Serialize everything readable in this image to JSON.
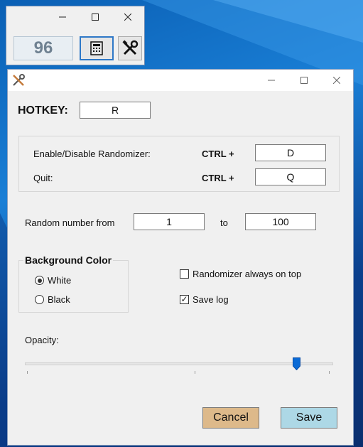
{
  "mini_window": {
    "counter_value": "96",
    "calc_icon": "calculator-icon",
    "tools_icon": "tools-icon"
  },
  "settings": {
    "app_icon": "tools-icon",
    "hotkey_label": "HOTKEY:",
    "hotkey_value": "R",
    "enable_label": "Enable/Disable Randomizer:",
    "enable_mod": "CTRL +",
    "enable_key": "D",
    "quit_label": "Quit:",
    "quit_mod": "CTRL +",
    "quit_key": "Q",
    "range_from_label": "Random number from",
    "range_from": "1",
    "range_to_label": "to",
    "range_to": "100",
    "bg_color": {
      "title": "Background Color",
      "white_label": "White",
      "black_label": "Black",
      "selected": "White"
    },
    "always_on_top_label": "Randomizer always on top",
    "always_on_top_checked": false,
    "save_log_label": "Save log",
    "save_log_checked": true,
    "opacity_label": "Opacity:",
    "opacity_value": 0.88,
    "cancel_label": "Cancel",
    "save_label": "Save",
    "cancel_color": "#ddb98a",
    "save_color": "#add8e6"
  }
}
